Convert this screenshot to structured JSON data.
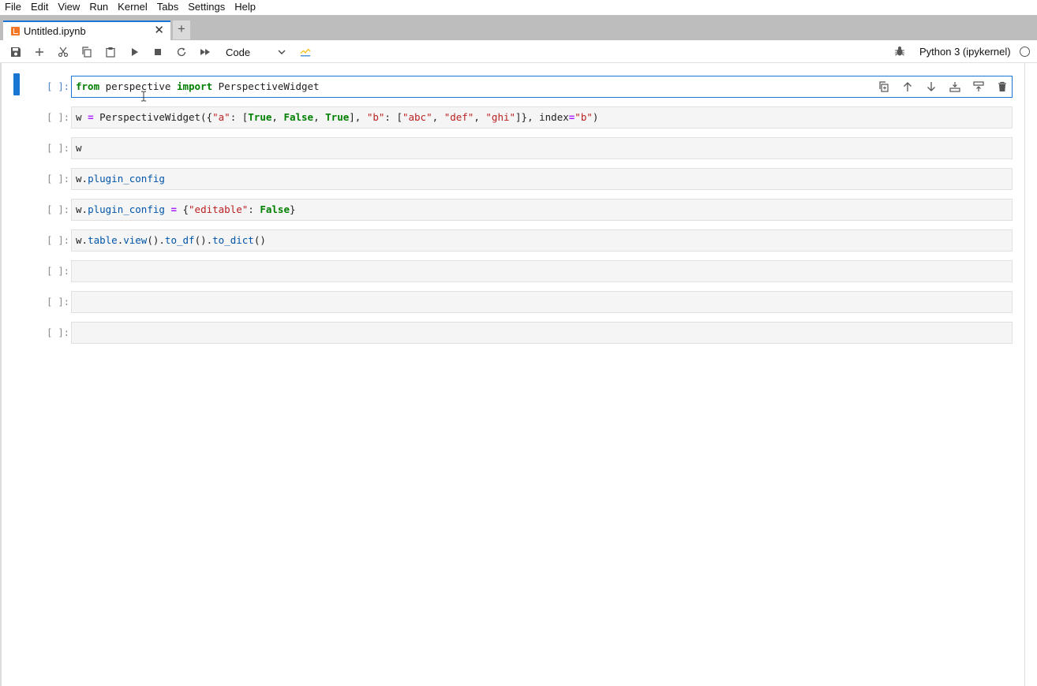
{
  "menu": [
    "File",
    "Edit",
    "View",
    "Run",
    "Kernel",
    "Tabs",
    "Settings",
    "Help"
  ],
  "tab": {
    "title": "Untitled.ipynb",
    "close": "✕",
    "add": "+"
  },
  "toolbar": {
    "cell_type": "Code",
    "kernel_name": "Python 3 (ipykernel)",
    "icons": [
      "save-icon",
      "add-cell-icon",
      "cut-icon",
      "copy-icon",
      "paste-icon",
      "run-icon",
      "stop-icon",
      "restart-icon",
      "fast-forward-icon",
      "chevron-down-icon",
      "tooltip-icon",
      "bug-icon",
      "kernel-idle-icon"
    ]
  },
  "cells": [
    {
      "prompt": "[ ]:",
      "active": true
    },
    {
      "prompt": "[ ]:"
    },
    {
      "prompt": "[ ]:"
    },
    {
      "prompt": "[ ]:"
    },
    {
      "prompt": "[ ]:"
    },
    {
      "prompt": "[ ]:"
    },
    {
      "prompt": "[ ]:"
    },
    {
      "prompt": "[ ]:"
    },
    {
      "prompt": "[ ]:"
    }
  ],
  "code": {
    "c1": {
      "kw1": "from",
      "mod": " perspective ",
      "kw2": "import",
      "name": " PerspectiveWidget"
    },
    "c2": {
      "a": "w ",
      "eq": "=",
      "b": " PerspectiveWidget({",
      "s1": "\"a\"",
      "c": ": [",
      "t1": "True",
      "d": ", ",
      "f1": "False",
      "e": ", ",
      "t2": "True",
      "g": "], ",
      "s2": "\"b\"",
      "h": ": [",
      "s3": "\"abc\"",
      "i": ", ",
      "s4": "\"def\"",
      "j": ", ",
      "s5": "\"ghi\"",
      "k": "]}, index",
      "eq2": "=",
      "s6": "\"b\"",
      "l": ")"
    },
    "c3": {
      "a": "w"
    },
    "c4": {
      "a": "w.",
      "attr": "plugin_config"
    },
    "c5": {
      "a": "w.",
      "attr": "plugin_config",
      "sp": " ",
      "eq": "=",
      "b": " {",
      "s": "\"editable\"",
      "c": ": ",
      "f": "False",
      "d": "}"
    },
    "c6": {
      "a": "w.",
      "t": "table",
      "d1": ".",
      "v": "view",
      "p1": "().",
      "df": "to_df",
      "p2": "().",
      "dict": "to_dict",
      "p3": "()"
    }
  },
  "colors": {
    "accent": "#1976d2",
    "keyword": "#008000",
    "operator": "#aa22ff",
    "string": "#ba2121",
    "attribute": "#0055aa"
  }
}
